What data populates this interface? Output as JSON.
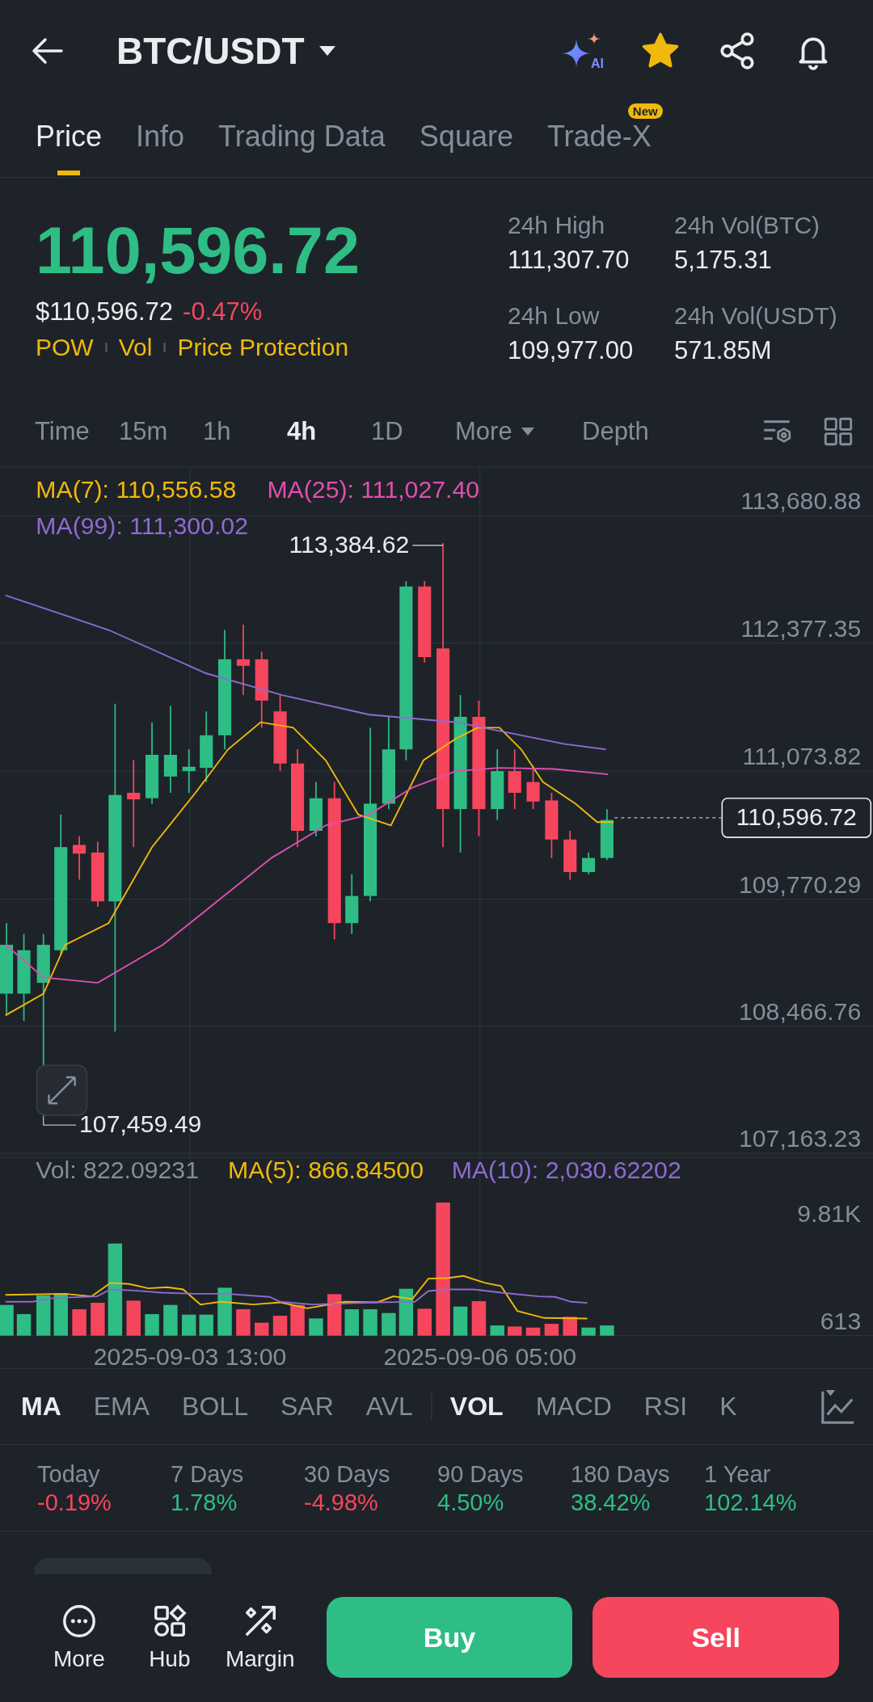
{
  "header": {
    "title": "BTC/USDT",
    "ai_badge": "AI",
    "favorite": true
  },
  "tabs": [
    {
      "label": "Price",
      "selected": true
    },
    {
      "label": "Info",
      "selected": false
    },
    {
      "label": "Trading Data",
      "selected": false
    },
    {
      "label": "Square",
      "selected": false
    },
    {
      "label": "Trade-X",
      "selected": false,
      "badge": "New"
    }
  ],
  "price": {
    "last": {
      "text": "110,596.72",
      "color": "#2ebd85"
    },
    "usd": "$110,596.72",
    "change": {
      "text": "-0.47%",
      "color": "#f6465d"
    },
    "tags": [
      "POW",
      "Vol",
      "Price Protection"
    ],
    "stats": [
      {
        "label": "24h High",
        "value": "111,307.70"
      },
      {
        "label": "24h Vol(BTC)",
        "value": "5,175.31"
      },
      {
        "label": "24h Low",
        "value": "109,977.00"
      },
      {
        "label": "24h Vol(USDT)",
        "value": "571.85M"
      }
    ]
  },
  "intervals": [
    {
      "label": "Time",
      "selected": false
    },
    {
      "label": "15m",
      "selected": false
    },
    {
      "label": "1h",
      "selected": false
    },
    {
      "label": "4h",
      "selected": true
    },
    {
      "label": "1D",
      "selected": false
    },
    {
      "label": "More",
      "selected": false,
      "dropdown": true
    },
    {
      "label": "Depth",
      "selected": false
    }
  ],
  "chart": {
    "ma_legend": [
      {
        "label": "MA(7): 110,556.58",
        "color": "#f0b90b"
      },
      {
        "label": "MA(25): 111,027.40",
        "color": "#e04fb0"
      },
      {
        "label": "MA(99): 111,300.02",
        "color": "#8e6bd1"
      }
    ],
    "price_ticks": [
      "113,680.88",
      "112,377.35",
      "111,073.82",
      "109,770.29",
      "108,466.76",
      "107,163.23"
    ],
    "high_label": "113,384.62",
    "low_label": "107,459.49",
    "last_price": "110,596.72",
    "volume_legend": [
      {
        "label": "Vol: 822.09231",
        "color": "#848e9c"
      },
      {
        "label": "MA(5): 866.84500",
        "color": "#f0b90b"
      },
      {
        "label": "MA(10): 2,030.62202",
        "color": "#8e6bd1"
      }
    ],
    "volume_ticks": [
      "9.81K",
      "613"
    ],
    "time_labels": [
      "2025-09-03 13:00",
      "2025-09-06 05:00"
    ]
  },
  "indicators": [
    {
      "label": "MA",
      "selected": true
    },
    {
      "label": "EMA",
      "selected": false
    },
    {
      "label": "BOLL",
      "selected": false
    },
    {
      "label": "SAR",
      "selected": false
    },
    {
      "label": "AVL",
      "selected": false,
      "divider_after": true
    },
    {
      "label": "VOL",
      "selected": true
    },
    {
      "label": "MACD",
      "selected": false
    },
    {
      "label": "RSI",
      "selected": false
    },
    {
      "label": "K",
      "selected": false
    }
  ],
  "performance": [
    {
      "label": "Today",
      "value": "-0.19%",
      "color": "#f6465d"
    },
    {
      "label": "7 Days",
      "value": "1.78%",
      "color": "#2ebd85"
    },
    {
      "label": "30 Days",
      "value": "-4.98%",
      "color": "#f6465d"
    },
    {
      "label": "90 Days",
      "value": "4.50%",
      "color": "#2ebd85"
    },
    {
      "label": "180 Days",
      "value": "38.42%",
      "color": "#2ebd85"
    },
    {
      "label": "1 Year",
      "value": "102.14%",
      "color": "#2ebd85"
    }
  ],
  "actions": [
    {
      "label": "More",
      "kind": "more"
    },
    {
      "label": "Hub",
      "kind": "hub"
    },
    {
      "label": "Margin",
      "kind": "margin"
    }
  ],
  "buy": "Buy",
  "sell": "Sell"
}
